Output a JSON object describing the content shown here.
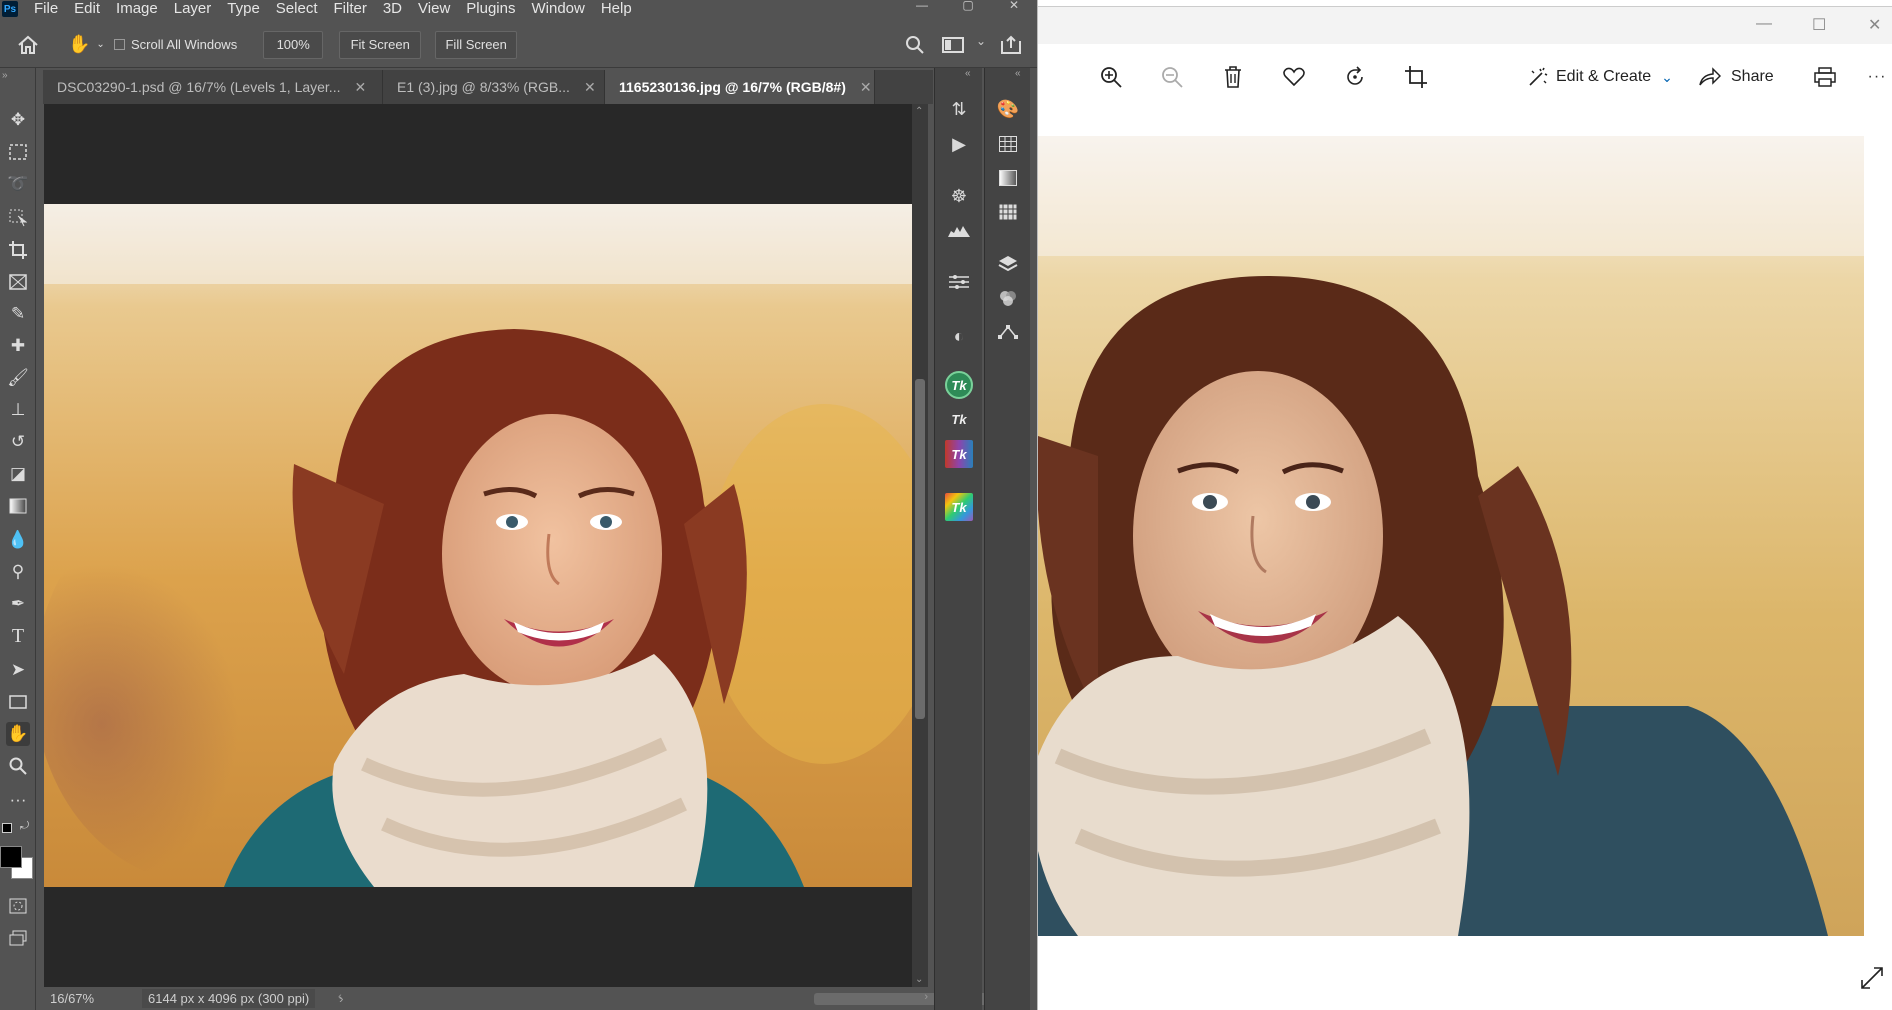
{
  "photoshop": {
    "menu": [
      "File",
      "Edit",
      "Image",
      "Layer",
      "Type",
      "Select",
      "Filter",
      "3D",
      "View",
      "Plugins",
      "Window",
      "Help"
    ],
    "logo": "Ps",
    "options": {
      "scroll_all_windows": "Scroll All Windows",
      "zoom_value": "100%",
      "fit_screen": "Fit Screen",
      "fill_screen": "Fill Screen"
    },
    "tabs": [
      {
        "label": "DSC03290-1.psd @ 16/7% (Levels 1, Layer..."
      },
      {
        "label": "E1 (3).jpg @ 8/33% (RGB..."
      },
      {
        "label": "1165230136.jpg @ 16/7% (RGB/8#)"
      }
    ],
    "status": {
      "zoom": "16/67%",
      "doc_info": "6144 px x 4096 px (300 ppi)"
    },
    "tool_icons": [
      "move-icon",
      "marquee-icon",
      "lasso-icon",
      "object-select-icon",
      "crop-icon",
      "frame-icon",
      "eyedropper-icon",
      "healing-icon",
      "brush-icon",
      "stamp-icon",
      "history-brush-icon",
      "eraser-icon",
      "gradient-icon",
      "blur-icon",
      "dodge-icon",
      "pen-icon",
      "type-icon",
      "path-select-icon",
      "rectangle-icon",
      "hand-icon",
      "zoom-icon",
      "more-tools-icon"
    ],
    "plugin_labels": {
      "tk": "Tk"
    }
  },
  "photos_app": {
    "edit_create": "Edit & Create",
    "share": "Share",
    "more": "···",
    "colors": {
      "accent": "#0063b1"
    }
  },
  "colors": {
    "ps_bg": "#535353",
    "ps_canvas": "#282828",
    "tk_green": "#2e8b57"
  }
}
